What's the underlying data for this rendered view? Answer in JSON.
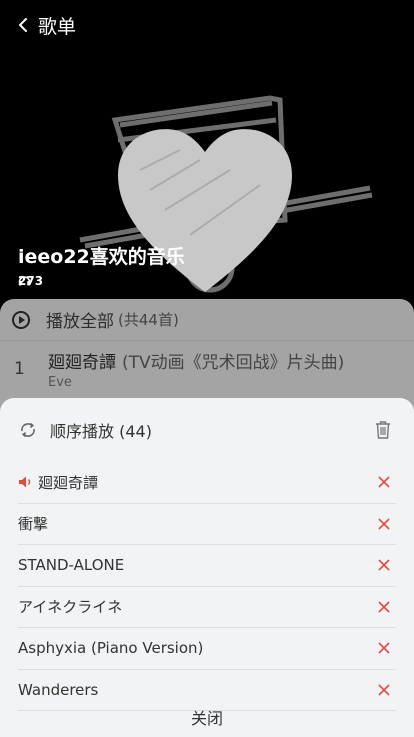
{
  "header": {
    "title": "歌单"
  },
  "playlist": {
    "name": "ieeo22喜欢的音乐",
    "play_count": "273"
  },
  "list": {
    "play_all_label": "播放全部",
    "play_all_count": "(共44首)",
    "songs": [
      {
        "index": "1",
        "name": "廻廻奇譚",
        "subtitle": "(TV动画《咒术回战》片头曲)",
        "artist": "Eve"
      }
    ]
  },
  "queue": {
    "mode_label": "顺序播放 (44)",
    "items": [
      {
        "name": "廻廻奇譚",
        "current": true
      },
      {
        "name": "衝撃",
        "current": false
      },
      {
        "name": "STAND-ALONE",
        "current": false
      },
      {
        "name": "アイネクライネ",
        "current": false
      },
      {
        "name": "Asphyxia (Piano Version)",
        "current": false
      },
      {
        "name": "Wanderers",
        "current": false
      }
    ],
    "close_label": "关闭"
  },
  "colors": {
    "accent_red": "#e24a3e",
    "sheet_bg": "#f2f3f5",
    "dim_panel": "#a4a4a4"
  }
}
